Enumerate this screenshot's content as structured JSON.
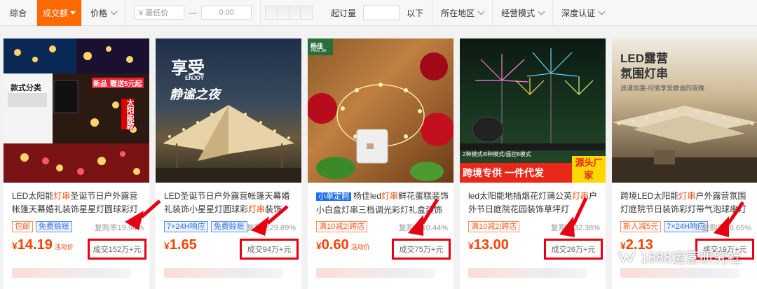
{
  "filter": {
    "sort_default": "综合",
    "sort_sales": "成交额",
    "sort_price": "价格",
    "min_price_placeholder": "¥ 最低价",
    "max_price_placeholder": "0.00",
    "min_qty_label": "起订量",
    "below_label": "以下",
    "region": "所在地区",
    "mode": "经营模式",
    "cert": "深度认证"
  },
  "colors": {
    "accent": "#ff6a00",
    "price": "#ff4000",
    "highlight_box": "#e60012"
  },
  "products": [
    {
      "image_icon": "solar-string-lights-collage",
      "image_texts": [
        "款式分类",
        "太阳能款",
        "新品",
        "赠送5元起"
      ],
      "title_prefix": "LED太阳能",
      "title_highlight": "灯串",
      "title_suffix": "圣诞节日户外露营帐篷天幕婚礼装饰星星灯圆球彩灯",
      "tags": [
        "包邮",
        "免费赊账"
      ],
      "repurchase": "复购率19.94%",
      "currency": "¥",
      "price": "14.19",
      "promo": "活动价",
      "sales": "成交152万+元"
    },
    {
      "image_icon": "camping-tent-night",
      "image_texts": [
        "享受",
        "ENJOY",
        "静谧之夜"
      ],
      "title_prefix": "LED圣诞节日户外露营帐篷天幕婚礼装饰小星星灯圆球彩",
      "title_highlight": "灯串",
      "title_suffix": "装饰",
      "tags": [
        "7×24H响应",
        "免费赊账"
      ],
      "repurchase": "复购率29.89%",
      "currency": "¥",
      "price": "1.65",
      "promo": "",
      "sales": "成交94万+元"
    },
    {
      "image_icon": "copper-wire-lights-battery-box",
      "image_texts": [
        "杨佳",
        "YANG JIA"
      ],
      "custom_tag": "小单定制",
      "title_prefix": "杨佳led",
      "title_highlight": "灯串",
      "title_suffix": "鲜花蛋糕装饰小白盒灯串三档调光彩灯礼盒装饰灯",
      "tags": [
        "满10减2|跨店"
      ],
      "repurchase": "复购率10.44%",
      "currency": "¥",
      "price": "0.60",
      "promo": "活动价",
      "sales": "成交75万+元"
    },
    {
      "image_icon": "solar-firework-garden-lights",
      "image_texts": [
        "2种模式/8种模式/遥控8模式",
        "跨境专供 一件代发",
        "源头厂家"
      ],
      "title_prefix": "led太阳能地插烟花灯蒲公英",
      "title_highlight": "灯串",
      "title_suffix": "户外节日庭院花园装饰草坪灯",
      "tags": [
        "满10减2|跨店"
      ],
      "repurchase": "复购率32.38%",
      "currency": "¥",
      "price": "13.00",
      "promo": "",
      "sales": "成交26万+元"
    },
    {
      "image_icon": "camping-canopy-string-lights",
      "image_texts": [
        "LED露营",
        "氛围灯串",
        "浪漫氛围-尽情享受静谧的夜晚"
      ],
      "title_prefix": "跨境LED太阳能",
      "title_highlight": "灯串",
      "title_suffix": "户外露营氛围灯庭院节日装饰彩灯带气泡球串灯",
      "tags": [
        "新人减5元",
        "7×24H响应"
      ],
      "repurchase": "复购率28.65%",
      "currency": "¥",
      "price": "2.13",
      "promo": "",
      "sales": "成交19万+元"
    }
  ],
  "watermark": {
    "icon": "wechat-channel-icon",
    "text": "1688运营研究社"
  }
}
